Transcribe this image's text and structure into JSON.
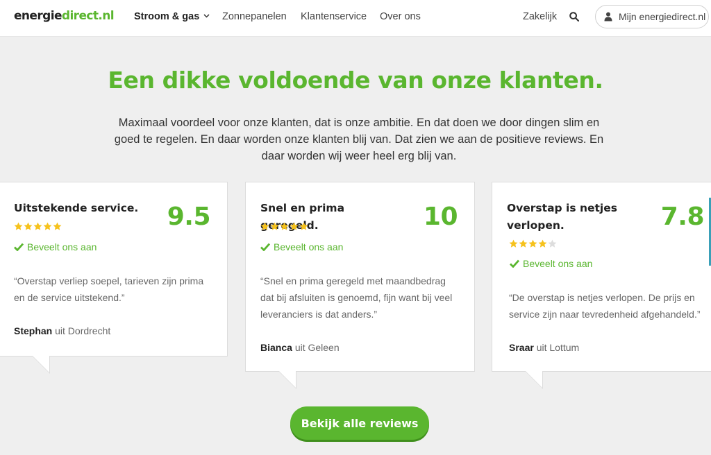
{
  "header": {
    "logo": {
      "part1": "energie",
      "part2": "direct",
      "part3": ".nl"
    },
    "nav": [
      "Stroom & gas",
      "Zonnepanelen",
      "Klantenservice",
      "Over ons"
    ],
    "business_label": "Zakelijk",
    "account_label": "Mijn energiedirect.nl"
  },
  "hero": {
    "title": "Een dikke voldoende van onze klanten.",
    "text": "Maximaal voordeel voor onze klanten, dat is onze ambitie. En dat doen we door dingen slim en goed te regelen. En daar worden onze klanten blij van. Dat zien we aan de positieve reviews. En daar worden wij weer heel erg blij van."
  },
  "reviews": [
    {
      "title": "Uitstekende service.",
      "score": "9.5",
      "stars": 5,
      "recommend": "Beveelt ons aan",
      "quote": "“Overstap verliep soepel, tarieven zijn prima en de service uitstekend.”",
      "author": "Stephan",
      "location": "uit Dordrecht"
    },
    {
      "title": "Snel en prima geregeld.",
      "score": "10",
      "stars": 5,
      "recommend": "Beveelt ons aan",
      "quote": "“Snel en prima geregeld met maandbedrag dat bij afsluiten is genoemd, fijn want bij veel leveranciers is dat anders.”",
      "author": "Bianca",
      "location": "uit Geleen"
    },
    {
      "title": "Overstap is netjes verlopen.",
      "score": "7.8",
      "stars": 4,
      "recommend": "Beveelt ons aan",
      "quote": "“De overstap is netjes verlopen. De prijs en service zijn naar tevredenheid afgehandeld.”",
      "author": "Sraar",
      "location": "uit Lottum"
    }
  ],
  "cta": {
    "label": "Bekijk alle reviews"
  },
  "colors": {
    "brand_green": "#5ab62f",
    "star": "#f6c21c",
    "star_empty": "#dddddd"
  }
}
